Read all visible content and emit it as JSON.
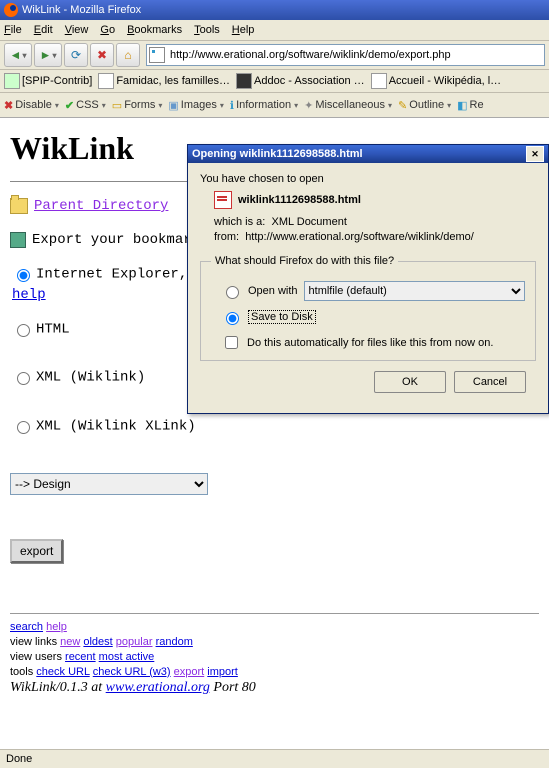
{
  "titlebar": {
    "title": "WikLink - Mozilla Firefox"
  },
  "menu": {
    "file": "File",
    "edit": "Edit",
    "view": "View",
    "go": "Go",
    "bookmarks": "Bookmarks",
    "tools": "Tools",
    "help": "Help"
  },
  "url": "http://www.erational.org/software/wiklink/demo/export.php",
  "bookmarks": [
    {
      "label": "[SPIP-Contrib]"
    },
    {
      "label": "Famidac, les familles…"
    },
    {
      "label": "Addoc - Association …"
    },
    {
      "label": "Accueil - Wikipédia, l…"
    }
  ],
  "wdtoolbar": {
    "disable": "Disable",
    "css": "CSS",
    "forms": "Forms",
    "images": "Images",
    "information": "Information",
    "miscellaneous": "Miscellaneous",
    "outline": "Outline",
    "resize": "Re"
  },
  "page": {
    "h1": "WikLink",
    "parent_dir": "Parent Directory",
    "export_label": "Export your bookmar",
    "radios": {
      "ie": "Internet Explorer, M",
      "help": "help",
      "html": "HTML",
      "xml1": "XML (Wiklink)",
      "xml2": "XML (Wiklink XLink)"
    },
    "design_option": "--> Design",
    "export_btn": "export"
  },
  "footer": {
    "search": "search",
    "help": "help",
    "line2_pre": "view links ",
    "new": "new",
    "oldest": "oldest",
    "popular": "popular",
    "random": "random",
    "line3_pre": "view users ",
    "recent": "recent",
    "most_active": "most active",
    "line4_pre": "tools ",
    "check_url": "check URL",
    "check_url_w3": "check URL (w3)",
    "export": "export",
    "import": "import",
    "sig_pre": "WikLink/0.1.3 at ",
    "sig_link": "www.erational.org",
    "sig_post": " Port 80"
  },
  "status": "Done",
  "dialog": {
    "title": "Opening wiklink1112698588.html",
    "chosen": "You have chosen to open",
    "filename": "wiklink1112698588.html",
    "which_is_label": "which is a:",
    "which_is_value": "XML Document",
    "from_label": "from:",
    "from_value": "http://www.erational.org/software/wiklink/demo/",
    "legend": "What should Firefox do with this file?",
    "open_with": "Open with",
    "open_with_value": "htmlfile (default)",
    "save": "Save to Disk",
    "auto": "Do this automatically for files like this from now on.",
    "ok": "OK",
    "cancel": "Cancel"
  }
}
